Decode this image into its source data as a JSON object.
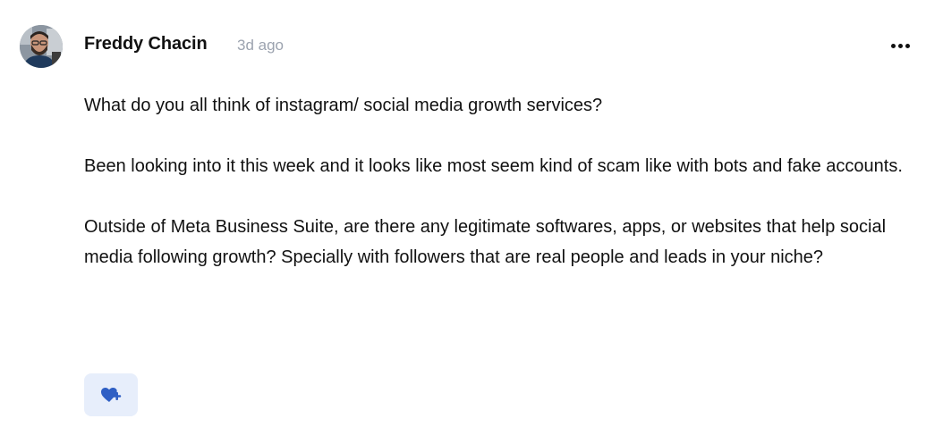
{
  "post": {
    "author_name": "Freddy Chacin",
    "time_ago": "3d ago",
    "paragraphs": [
      "What do you all think of instagram/ social media growth services?",
      "Been looking into it this week and it looks like most seem kind of scam like with bots and fake accounts.",
      "Outside of Meta Business Suite, are there any legitimate softwares, apps, or websites that help social media following growth? Specially with followers that are real people and leads in your niche?"
    ],
    "icons": {
      "avatar": "user-avatar",
      "more": "more-horizontal-icon",
      "react": "heart-plus-icon"
    },
    "colors": {
      "react_bg": "#e7eefb",
      "react_icon": "#2f5fc4",
      "meta_text": "#9ca3af"
    }
  }
}
